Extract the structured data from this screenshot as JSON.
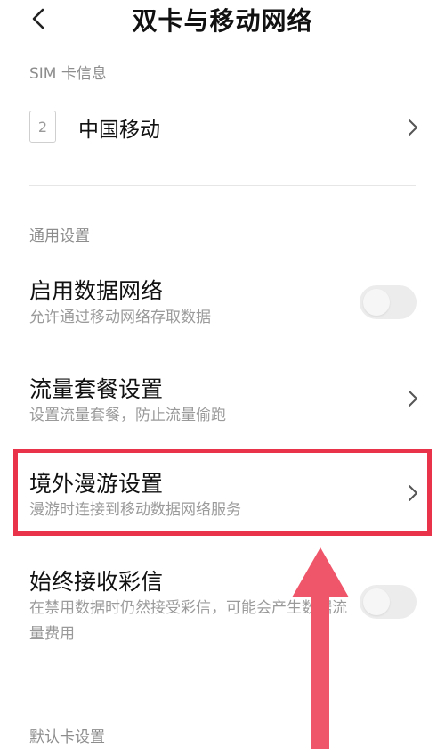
{
  "header": {
    "title": "双卡与移动网络",
    "back_icon": "chevron-left-icon"
  },
  "sim_section": {
    "label": "SIM 卡信息",
    "sim_slot_number": "2",
    "carrier_name": "中国移动"
  },
  "general_section": {
    "label": "通用设置",
    "items": [
      {
        "title": "启用数据网络",
        "subtitle": "允许通过移动网络存取数据",
        "control": "toggle",
        "enabled": false
      },
      {
        "title": "流量套餐设置",
        "subtitle": "设置流量套餐，防止流量偷跑",
        "control": "chevron"
      },
      {
        "title": "境外漫游设置",
        "subtitle": "漫游时连接到移动数据网络服务",
        "control": "chevron"
      },
      {
        "title": "始终接收彩信",
        "subtitle": "在禁用数据时仍然接受彩信，可能会产生数据流量费用",
        "control": "toggle",
        "enabled": false
      }
    ]
  },
  "default_card_section": {
    "label": "默认卡设置"
  },
  "annotation": {
    "highlight_color": "#e8334a",
    "arrow_color": "#f0566a"
  }
}
